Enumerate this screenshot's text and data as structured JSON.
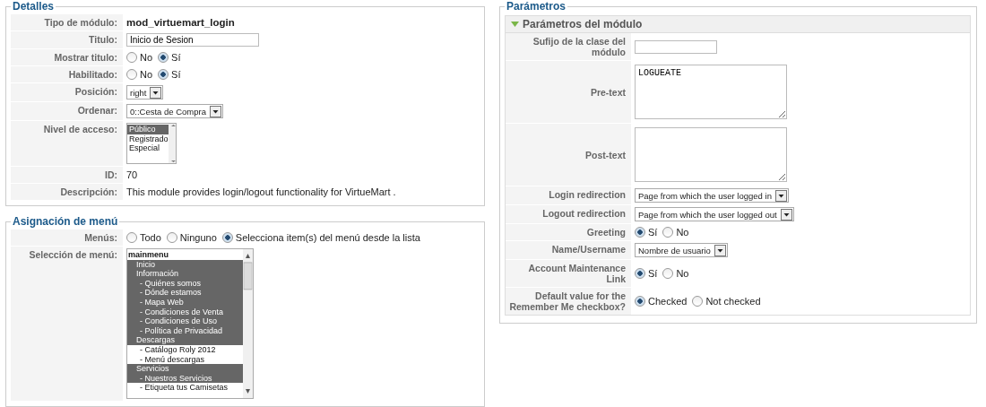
{
  "details": {
    "legend": "Detalles",
    "rows": [
      {
        "kind": "text",
        "label": "Tipo de módulo:",
        "value": "mod_virtuemart_login",
        "bold": true
      },
      {
        "kind": "input",
        "label": "Titulo:",
        "value": "Inicio de Sesion"
      },
      {
        "kind": "radio",
        "label": "Mostrar titulo:",
        "options": [
          {
            "label": "No",
            "selected": false
          },
          {
            "label": "Sí",
            "selected": true
          }
        ]
      },
      {
        "kind": "radio",
        "label": "Habilitado:",
        "options": [
          {
            "label": "No",
            "selected": false
          },
          {
            "label": "Sí",
            "selected": true
          }
        ]
      },
      {
        "kind": "select",
        "label": "Posición:",
        "value": "right"
      },
      {
        "kind": "select",
        "label": "Ordenar:",
        "value": "0::Cesta de Compra"
      },
      {
        "kind": "listbox",
        "label": "Nivel de acceso:",
        "options": [
          {
            "label": "Público",
            "selected": true
          },
          {
            "label": "Registrado",
            "selected": false
          },
          {
            "label": "Especial",
            "selected": false
          }
        ]
      },
      {
        "kind": "text",
        "label": "ID:",
        "value": "70",
        "bold": false
      },
      {
        "kind": "text",
        "label": "Descripción:",
        "value": "This module provides login/logout functionality for VirtueMart .",
        "bold": false
      }
    ]
  },
  "menu_assignment": {
    "legend": "Asignación de menú",
    "menus": {
      "label": "Menús:",
      "options": [
        {
          "label": "Todo",
          "selected": false
        },
        {
          "label": "Ninguno",
          "selected": false
        },
        {
          "label": "Selecciona item(s) del menú desde la lista",
          "selected": true
        }
      ]
    },
    "selection": {
      "label": "Selección de menú:",
      "group": "mainmenu",
      "items": [
        {
          "label": "Inicio",
          "selected": true
        },
        {
          "label": "Información",
          "selected": true,
          "children": [
            {
              "label": "- Quiénes somos",
              "selected": true
            },
            {
              "label": "- Dónde estamos",
              "selected": true
            },
            {
              "label": "- Mapa Web",
              "selected": true
            },
            {
              "label": "- Condiciones de Venta",
              "selected": true
            },
            {
              "label": "- Condiciones de Uso",
              "selected": true
            },
            {
              "label": "- Política de Privacidad",
              "selected": true
            }
          ]
        },
        {
          "label": "Descargas",
          "selected": true,
          "children": [
            {
              "label": "- Catálogo Roly 2012",
              "selected": false
            },
            {
              "label": "- Menú descargas",
              "selected": false
            }
          ]
        },
        {
          "label": "Servicios",
          "selected": true,
          "children": [
            {
              "label": "- Nuestros Servicios",
              "selected": true
            },
            {
              "label": "- Etiqueta tus Camisetas",
              "selected": false
            }
          ]
        }
      ]
    }
  },
  "parameters": {
    "legend": "Parámetros",
    "panel": {
      "title": "Parámetros del módulo",
      "expanded": true,
      "rows": [
        {
          "kind": "input",
          "label": "Sufijo de la clase del módulo",
          "value": ""
        },
        {
          "kind": "textarea",
          "label": "Pre-text",
          "value": "LOGUEATE"
        },
        {
          "kind": "textarea",
          "label": "Post-text",
          "value": ""
        },
        {
          "kind": "select",
          "label": "Login redirection",
          "value": "Page from which the user logged in"
        },
        {
          "kind": "select",
          "label": "Logout redirection",
          "value": "Page from which the user logged out"
        },
        {
          "kind": "radio",
          "label": "Greeting",
          "options": [
            {
              "label": "Sí",
              "selected": true
            },
            {
              "label": "No",
              "selected": false
            }
          ]
        },
        {
          "kind": "select",
          "label": "Name/Username",
          "value": "Nombre de usuario"
        },
        {
          "kind": "radio",
          "label": "Account Maintenance Link",
          "options": [
            {
              "label": "Sí",
              "selected": true
            },
            {
              "label": "No",
              "selected": false
            }
          ]
        },
        {
          "kind": "radio",
          "label": "Default value for the Remember Me checkbox?",
          "options": [
            {
              "label": "Checked",
              "selected": true
            },
            {
              "label": "Not checked",
              "selected": false
            }
          ]
        }
      ]
    }
  }
}
